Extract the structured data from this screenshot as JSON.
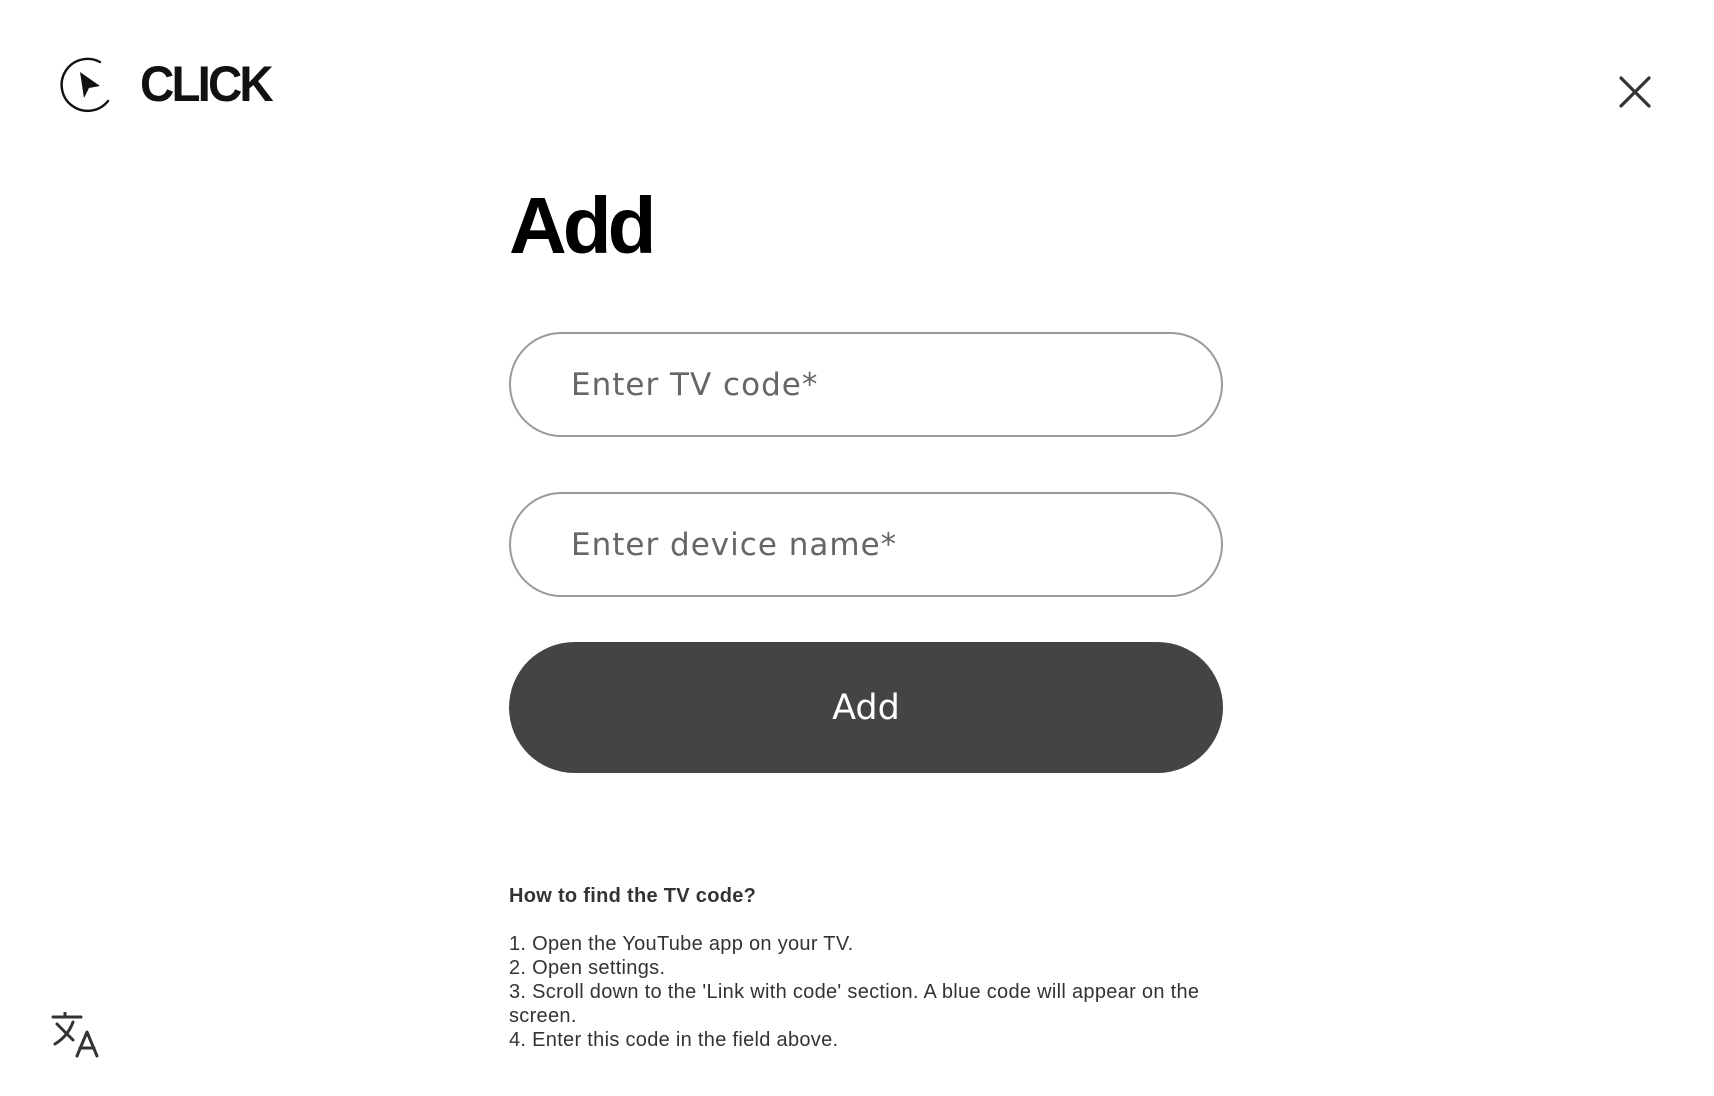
{
  "header": {
    "logo_text": "CLICK",
    "logo_icon": "play-cursor-circle-icon",
    "close_icon": "close-icon"
  },
  "main": {
    "title": "Add",
    "tv_code_placeholder": "Enter TV code*",
    "device_name_placeholder": "Enter device name*",
    "submit_label": "Add"
  },
  "help": {
    "title": "How to find the TV code?",
    "steps": [
      "1. Open the YouTube app on your TV.",
      "2. Open settings.",
      "3. Scroll down to the 'Link with code' section. A blue code will appear on the screen.",
      "4. Enter this code in the field above."
    ]
  },
  "footer": {
    "language_icon": "translate-icon"
  },
  "colors": {
    "button_bg": "#444444",
    "button_text": "#ffffff",
    "field_border": "#9a9a9a",
    "title": "#000000",
    "help_text": "#333333"
  }
}
